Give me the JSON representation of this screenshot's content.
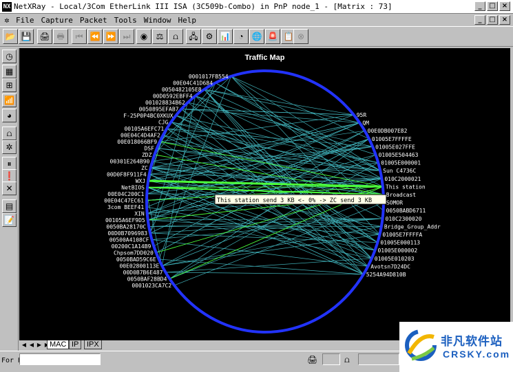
{
  "window": {
    "title": "NetXRay - Local/3Com EtherLink III ISA (3C509b-Combo) in PnP node_1 - [Matrix : 73]",
    "app_icon_label": "NX",
    "buttons": {
      "minimize": "_",
      "maximize": "□",
      "close": "×"
    }
  },
  "menu": {
    "items": [
      "File",
      "Capture",
      "Packet",
      "Tools",
      "Window",
      "Help"
    ],
    "hotkeys": [
      "F",
      "C",
      "P",
      "T",
      "W",
      "H"
    ]
  },
  "toolbar_icons": [
    {
      "name": "open-icon",
      "glyph": "📂",
      "enabled": true
    },
    {
      "name": "save-icon",
      "glyph": "💾",
      "enabled": true
    },
    {
      "name": "print-icon",
      "glyph": "🖨",
      "enabled": true
    },
    {
      "name": "print-preview-icon",
      "glyph": "🖶",
      "enabled": false
    },
    {
      "name": "first-icon",
      "glyph": "⏮",
      "enabled": false
    },
    {
      "name": "prev-icon",
      "glyph": "⏪",
      "enabled": false
    },
    {
      "name": "next-icon",
      "glyph": "⏩",
      "enabled": false
    },
    {
      "name": "last-icon",
      "glyph": "⏭",
      "enabled": false
    },
    {
      "name": "capture-icon",
      "glyph": "◉",
      "enabled": true
    },
    {
      "name": "scale-icon",
      "glyph": "⚖",
      "enabled": true
    },
    {
      "name": "transmit-icon",
      "glyph": "⩍",
      "enabled": true
    },
    {
      "name": "network-icon",
      "glyph": "🖧",
      "enabled": true
    },
    {
      "name": "settings-icon",
      "glyph": "⚙",
      "enabled": true
    },
    {
      "name": "bar-chart-icon",
      "glyph": "📊",
      "enabled": true
    },
    {
      "name": "pie-chart-icon",
      "glyph": "◔",
      "enabled": true
    },
    {
      "name": "globe-icon",
      "glyph": "🌐",
      "enabled": true
    },
    {
      "name": "alarm-icon",
      "glyph": "🚨",
      "enabled": true
    },
    {
      "name": "log-icon",
      "glyph": "📋",
      "enabled": true
    },
    {
      "name": "stop-icon",
      "glyph": "⊗",
      "enabled": false
    }
  ],
  "left_toolbar_icons": [
    {
      "name": "dashboard-icon",
      "glyph": "◷"
    },
    {
      "name": "host-table-icon",
      "glyph": "▦"
    },
    {
      "name": "matrix-icon",
      "glyph": "⊞"
    },
    {
      "name": "history-icon",
      "glyph": "📶"
    },
    {
      "name": "protocol-icon",
      "glyph": "◕"
    },
    {
      "name": "packet-gen-icon",
      "glyph": "⩍"
    },
    {
      "name": "tools-icon",
      "glyph": "✲"
    },
    {
      "name": "pause-icon",
      "glyph": "⏸"
    },
    {
      "name": "alert-icon",
      "glyph": "❗"
    },
    {
      "name": "cancel-icon",
      "glyph": "✕"
    },
    {
      "name": "grid-icon",
      "glyph": "▤"
    },
    {
      "name": "note-icon",
      "glyph": "📝"
    }
  ],
  "traffic_map": {
    "title": "Traffic Map",
    "tooltip": "This station send 3 KB <- 0% -> ZC send 3 KB",
    "colors": {
      "ring": "#2233ff",
      "line": "#3fb0b8",
      "highlight": "#4cff3a",
      "background": "#000000",
      "label": "#ffffff"
    },
    "left_nodes": [
      "0001017FB554",
      "00E04C41D684",
      "0050482105E8",
      "00D0592EBFF4",
      "001028834B62",
      "0050895EFAB7",
      "F-25P0P4BC0XKUX",
      "CJG",
      "00105A6EFC71",
      "00E04C4D4AF2",
      "00E018066BF9",
      "DSF",
      "ZDZ",
      "00301E264B90",
      "ZC",
      "00D0F8F911F4",
      "WXJ",
      "NetBIOS",
      "00E04C200C1",
      "00E04C47EC61",
      "3com    BEEF41",
      "XIN",
      "00105A6EF9D5",
      "0050BA28170C",
      "00D0B7096983",
      "00500A4108CF",
      "00200C1A14B9",
      "Chpsom7DD020",
      "0050BAD59C6E",
      "00E02800113E",
      "00D0B7B6E487",
      "0050BAF28BD4",
      "0001023CA7C2"
    ],
    "right_nodes": [
      "95R",
      "QM",
      "00E0DB007E82",
      "01005E7FFFFE",
      "01005E027FFE",
      "01005E504463",
      "01005E000001",
      "Sun    C4736C",
      "010C2000021",
      "This station",
      "Broadcast",
      "SOMOR",
      "0050BABD6711",
      "010C2300020",
      "Bridge_Group_Addr",
      "01005E7FFFFA",
      "01005E000113",
      "01005E000002",
      "01005E010203",
      "Avotsn7D24DC",
      "5254A94D810B"
    ]
  },
  "tabs": {
    "items": [
      "MAC",
      "IP",
      "IPX"
    ],
    "active": "MAC",
    "arrows": [
      "◀",
      "◀",
      "▶",
      "▶"
    ]
  },
  "status": {
    "text": "For H",
    "icons": [
      {
        "name": "printer-status-icon",
        "glyph": "🖨"
      },
      {
        "name": "scale-status-icon",
        "glyph": "⩍"
      }
    ]
  },
  "watermark": {
    "cn": "非凡软件站",
    "en": "CRSKY.com"
  }
}
